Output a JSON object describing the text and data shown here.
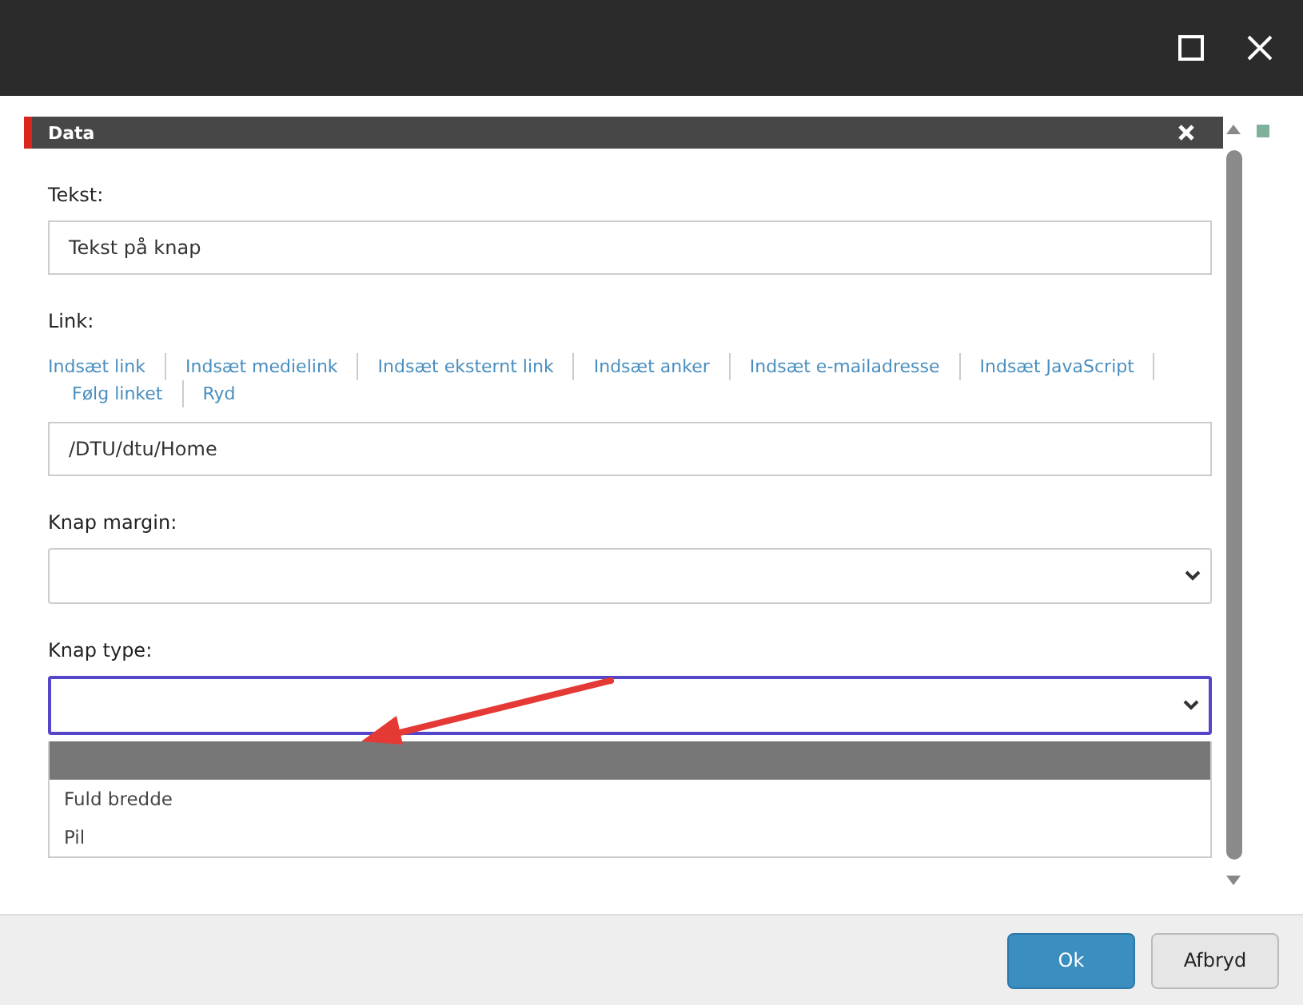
{
  "panel": {
    "title": "Data"
  },
  "fields": [
    {
      "kind": "text",
      "label": "Tekst:",
      "value": "Tekst på knap"
    },
    {
      "kind": "link",
      "label": "Link:",
      "links": [
        "Indsæt link",
        "Indsæt medielink",
        "Indsæt eksternt link",
        "Indsæt anker",
        "Indsæt e-mailadresse",
        "Indsæt JavaScript",
        "Følg linket",
        "Ryd"
      ],
      "value": "/DTU/dtu/Home"
    },
    {
      "kind": "select",
      "label": "Knap margin:",
      "focused": false
    },
    {
      "kind": "select",
      "label": "Knap type:",
      "focused": true,
      "options": [
        {
          "selected": true
        },
        {
          "label": "Fuld bredde",
          "selected": false
        },
        {
          "label": "Pil",
          "selected": false
        }
      ]
    }
  ],
  "buttons": [
    {
      "label": "Ok",
      "kind": "primary"
    },
    {
      "label": "Afbryd",
      "kind": "secondary"
    }
  ]
}
